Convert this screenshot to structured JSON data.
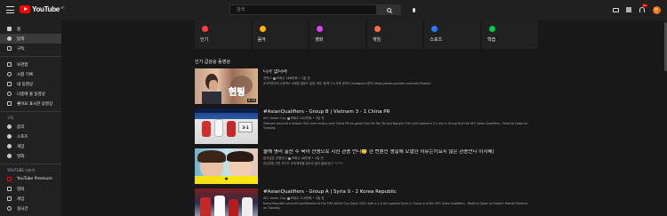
{
  "header": {
    "logo_text": "YouTube",
    "logo_region": "KR",
    "search_placeholder": "검색",
    "notification_count": "9+",
    "avatar_initial": "연"
  },
  "sidebar": {
    "main_items": [
      {
        "label": "홈",
        "icon": "home-icon"
      },
      {
        "label": "탐색",
        "icon": "explore-icon",
        "active": true
      },
      {
        "label": "구독",
        "icon": "subscriptions-icon"
      }
    ],
    "library_items": [
      {
        "label": "보관함",
        "icon": "library-icon"
      },
      {
        "label": "시청 기록",
        "icon": "history-icon"
      },
      {
        "label": "내 동영상",
        "icon": "my-videos-icon"
      },
      {
        "label": "나중에 볼 동영상",
        "icon": "watch-later-icon"
      },
      {
        "label": "좋아요 표시한 동영상",
        "icon": "liked-videos-icon"
      }
    ],
    "subscriptions_heading": "구독",
    "subscription_items": [
      {
        "label": "음악"
      },
      {
        "label": "스포츠"
      },
      {
        "label": "게임"
      },
      {
        "label": "영화"
      }
    ],
    "more_heading": "YOUTUBE 더보기",
    "more_items": [
      {
        "label": "YouTube Premium"
      },
      {
        "label": "영화"
      },
      {
        "label": "게임"
      },
      {
        "label": "실시간"
      }
    ]
  },
  "categories": [
    {
      "label": "인기",
      "icon": "trending-icon",
      "color": "#ff3d3d"
    },
    {
      "label": "음악",
      "icon": "music-icon",
      "color": "#ffb300"
    },
    {
      "label": "영화",
      "icon": "movies-icon",
      "color": "#e040fb"
    },
    {
      "label": "게임",
      "icon": "gaming-icon",
      "color": "#ff6e40"
    },
    {
      "label": "스포츠",
      "icon": "sports-icon",
      "color": "#2979ff"
    },
    {
      "label": "학습",
      "icon": "learning-icon",
      "color": "#00c853"
    }
  ],
  "section_title": "인기 급상승 동영상",
  "videos": [
    {
      "title": "니가 없더라",
      "channel": "숏박스",
      "meta": "조회수 186만회 • 1일 전",
      "desc": "#코빅숏무비 #숏박스 #현팅 업로드 일정: 매주 월/목 7시 오후 숏박스 Instagram\n문의: https://www.youtube.com/user/Gwoo4",
      "duration": "6:16"
    },
    {
      "title": "#AsianQualifiers - Group B | Vietnam 3 - 1 China PR",
      "channel": "AFC Asian Cup",
      "meta": "조회수 262만회 • 3일 전",
      "desc": "Vietnam secured a historic first-ever victory over China PR as goals from Ho Tan Tai and Nguyen Tien Linh sealed a 3-1 win in Group B of the AFC Asian Qualifiers - Road to Qatar on Tuesday.",
      "duration": ""
    },
    {
      "title": "올해 명리 출산 수 육아 전쟁으로 지친 관종 언니🙂 한 번뿐인 생일에 오열한 이유는?(요지 많은 관종언니 이지혜)",
      "channel": "밉지않은 관종언니",
      "meta": "조회수 46만회 • 1일 전",
      "desc": "관심지원 가판 지기가 크게 축하할 정도로 많이 울었다는? ㅋㅋㅋ",
      "duration": ""
    },
    {
      "title": "#AsianQualifiers - Group A | Syria 0 - 2 Korea Republic",
      "channel": "AFC Asian Cup",
      "meta": "조회수 116만회 • 3일 전",
      "desc": "Korea Republic secured qualification to the FIFA World Cup Qatar 2022 with a 2-0 win against Syria in Group A of the AFC Asian Qualifiers - Road to Qatar at Dubai's Rashid Stadium on Tuesday.",
      "duration": ""
    }
  ]
}
